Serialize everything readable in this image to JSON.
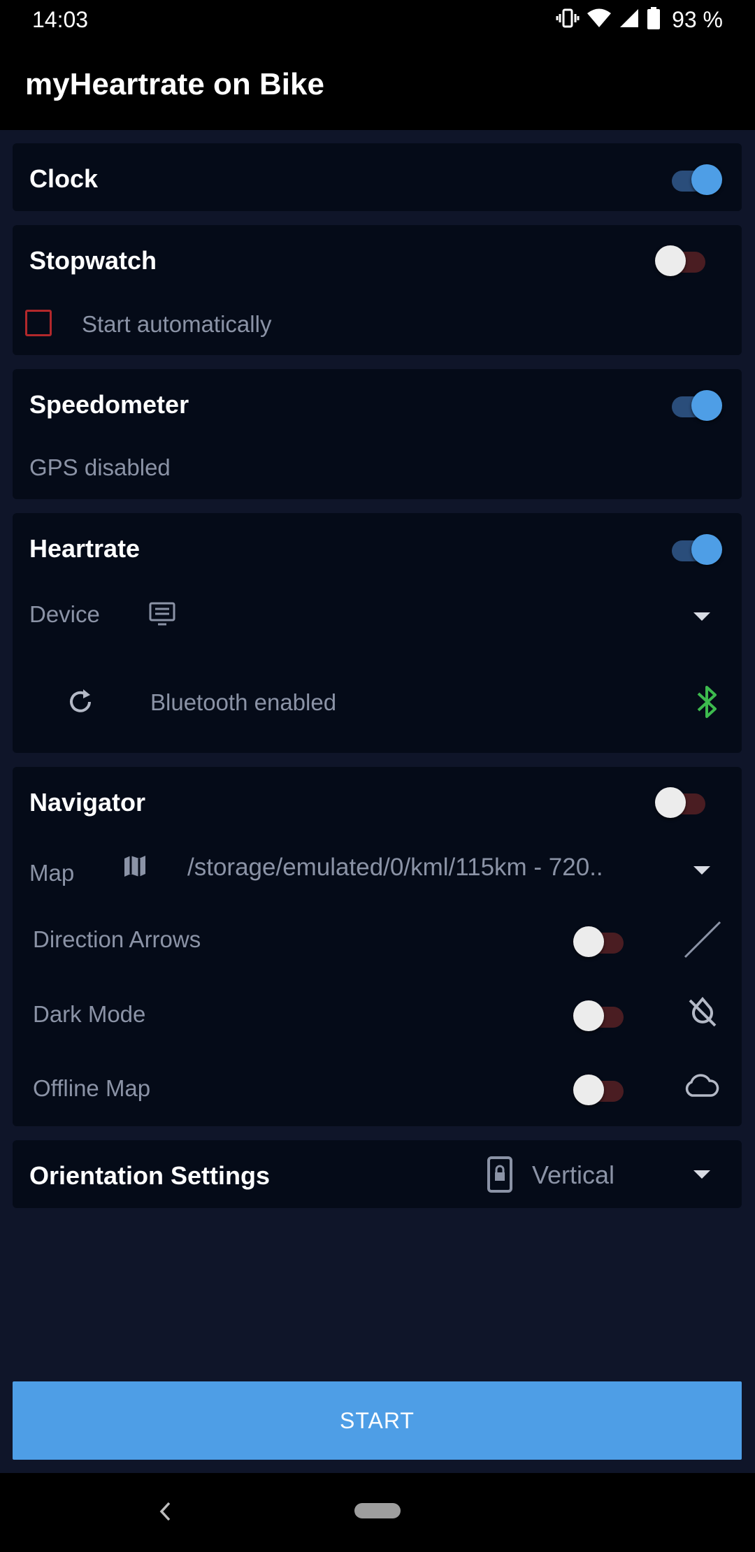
{
  "status_bar": {
    "time": "14:03",
    "battery": "93 %",
    "icons": [
      "vibrate-icon",
      "wifi-icon",
      "signal-icon",
      "battery-icon"
    ]
  },
  "app_bar": {
    "title": "myHeartrate on Bike"
  },
  "clock": {
    "title": "Clock",
    "enabled": true
  },
  "stopwatch": {
    "title": "Stopwatch",
    "enabled": false,
    "auto_start_label": "Start automatically",
    "auto_start_checked": false
  },
  "speedometer": {
    "title": "Speedometer",
    "enabled": true,
    "status": "GPS disabled"
  },
  "heartrate": {
    "title": "Heartrate",
    "enabled": true,
    "device_label": "Device",
    "bluetooth_status": "Bluetooth enabled"
  },
  "navigator": {
    "title": "Navigator",
    "enabled": false,
    "map_label": "Map",
    "map_path": "/storage/emulated/0/kml/115km - 720..",
    "direction_arrows_label": "Direction Arrows",
    "direction_arrows": false,
    "dark_mode_label": "Dark Mode",
    "dark_mode": false,
    "offline_map_label": "Offline Map",
    "offline_map": false
  },
  "orientation": {
    "title": "Orientation Settings",
    "value": "Vertical"
  },
  "start_button": {
    "label": "START"
  },
  "colors": {
    "background": "#0f1529",
    "card": "#050b18",
    "accent": "#4e9ee6",
    "toggle_off_track": "#4a1d22",
    "bluetooth": "#3dba4e",
    "checkbox": "#b2282b"
  }
}
